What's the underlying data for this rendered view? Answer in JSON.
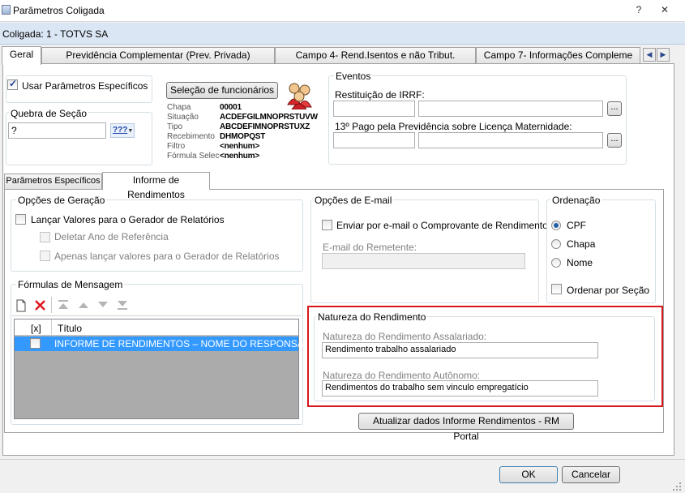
{
  "window": {
    "title": "Parâmetros Coligada",
    "help_label": "?",
    "close_label": "✕"
  },
  "coligada": {
    "label": "Coligada: 1 - TOTVS SA"
  },
  "tabs": [
    {
      "label": "Geral"
    },
    {
      "label": "Previdência Complementar (Prev. Privada)"
    },
    {
      "label": "Campo 4- Rend.Isentos e não Tribut."
    },
    {
      "label": "Campo 7- Informações Compleme"
    }
  ],
  "general": {
    "use_specific_params": {
      "label": "Usar Parâmetros Específicos",
      "checked": true
    },
    "section_break": {
      "label": "Quebra de Seção",
      "value": "?",
      "lookup_label": "???"
    },
    "employee_selection": {
      "button_label": "Seleção de funcionários",
      "fields": [
        {
          "label": "Chapa",
          "value": "00001"
        },
        {
          "label": "Situação",
          "value": "ACDEFGILMNOPRSTUVW"
        },
        {
          "label": "Tipo",
          "value": "ABCDEFIMNOPRSTUXZ"
        },
        {
          "label": "Recebimento",
          "value": "DHMOPQST"
        },
        {
          "label": "Filtro",
          "value": "<nenhum>"
        },
        {
          "label": "Fórmula Selec",
          "value": "<nenhum>"
        }
      ]
    },
    "eventos": {
      "title": "Eventos",
      "irrf": {
        "label": "Restituição de IRRF:",
        "code": "",
        "desc": "",
        "button_label": "..."
      },
      "decimo": {
        "label": "13º Pago pela Previdência sobre Licença Maternidade:",
        "code": "",
        "desc": "",
        "button_label": "..."
      }
    }
  },
  "subtabs": [
    {
      "label": "Parâmetros Específicos"
    },
    {
      "label": "Informe de Rendimentos"
    }
  ],
  "geracao": {
    "title": "Opções de Geração",
    "items": [
      {
        "label": "Lançar Valores para o Gerador de Relatórios",
        "checked": false
      },
      {
        "label": "Deletar Ano de Referência",
        "checked": false
      },
      {
        "label": "Apenas lançar valores para o Gerador de Relatórios",
        "checked": false
      }
    ]
  },
  "email": {
    "title": "Opções de E-mail",
    "send": {
      "label": "Enviar por e-mail o Comprovante de Rendimentos",
      "checked": false
    },
    "sender": {
      "label": "E-mail do Remetente:",
      "value": ""
    }
  },
  "ordenacao": {
    "title": "Ordenação",
    "options": [
      {
        "label": "CPF",
        "selected": true
      },
      {
        "label": "Chapa",
        "selected": false
      },
      {
        "label": "Nome",
        "selected": false
      }
    ],
    "by_section": {
      "label": "Ordenar por Seção",
      "checked": false
    }
  },
  "formulas": {
    "title": "Fórmulas de Mensagem",
    "columns": [
      "[x]",
      "Título"
    ],
    "rows": [
      {
        "checked": false,
        "title": "INFORME DE RENDIMENTOS – NOME DO RESPONSAVE..."
      }
    ]
  },
  "natureza": {
    "title": "Natureza do Rendimento",
    "assalariado": {
      "label": "Natureza do Rendimento Assalariado:",
      "value": "Rendimento trabalho assalariado"
    },
    "autonomo": {
      "label": "Natureza do Rendimento Autônomo:",
      "value": "Rendimentos do trabalho sem vinculo empregatício"
    },
    "highlight_color": "#d9161c"
  },
  "update_button": {
    "label": "Atualizar dados Informe Rendimentos - RM Portal"
  },
  "footer": {
    "ok_label": "OK",
    "cancel_label": "Cancelar"
  }
}
